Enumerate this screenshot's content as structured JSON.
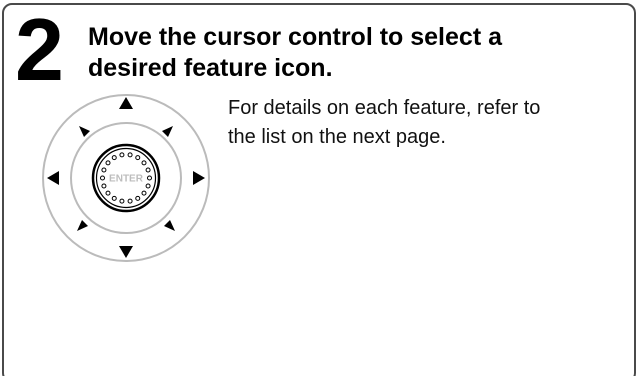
{
  "step": {
    "number": "2",
    "title_line1": "Move the cursor control to select a",
    "title_line2": "desired feature icon."
  },
  "description": {
    "line1": "For details on each feature, refer to",
    "line2": "the list on the next page."
  },
  "cursor_control": {
    "center_label": "ENTER",
    "arrows": [
      "up",
      "up-right",
      "right",
      "down-right",
      "down",
      "down-left",
      "left",
      "up-left"
    ]
  },
  "colors": {
    "frame": "#4a4a4a",
    "ring": "#bbbbbb",
    "text": "#000000"
  }
}
